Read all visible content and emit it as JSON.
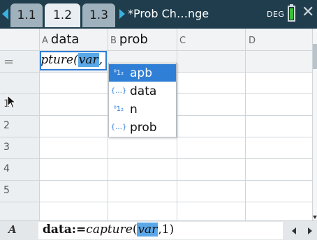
{
  "tabs": [
    {
      "label": "1.1"
    },
    {
      "label": "1.2",
      "active": true
    },
    {
      "label": "1.3"
    }
  ],
  "document_title": "*Prob Ch…nge",
  "angle_mode": "DEG",
  "columns": [
    {
      "letter": "A",
      "name": "data"
    },
    {
      "letter": "B",
      "name": "prob"
    },
    {
      "letter": "C",
      "name": ""
    },
    {
      "letter": "D",
      "name": ""
    }
  ],
  "formula_row_symbol": "=",
  "formula_cell": {
    "prefix": "pture(",
    "selected": "var",
    "suffix": ","
  },
  "rows": [
    "1",
    "2",
    "3",
    "4",
    "5"
  ],
  "autocomplete": [
    {
      "icon": "numeric-var-icon",
      "icon_text": "⁰1₂",
      "label": "apb",
      "selected": true
    },
    {
      "icon": "list-var-icon",
      "icon_text": "{…}",
      "label": "data",
      "selected": false
    },
    {
      "icon": "numeric-var-icon",
      "icon_text": "⁰1₂",
      "label": "n",
      "selected": false
    },
    {
      "icon": "list-var-icon",
      "icon_text": "{…}",
      "label": "prob",
      "selected": false
    }
  ],
  "entry_line": {
    "cell_ref": "A",
    "var_part": "data:=",
    "func_part": "capture",
    "open_paren": "(",
    "selected": "var",
    "rest": ",1)"
  },
  "colors": {
    "accent": "#2f7fd6",
    "selection": "#5aa8e8",
    "titlebar": "#1f3d4d"
  }
}
